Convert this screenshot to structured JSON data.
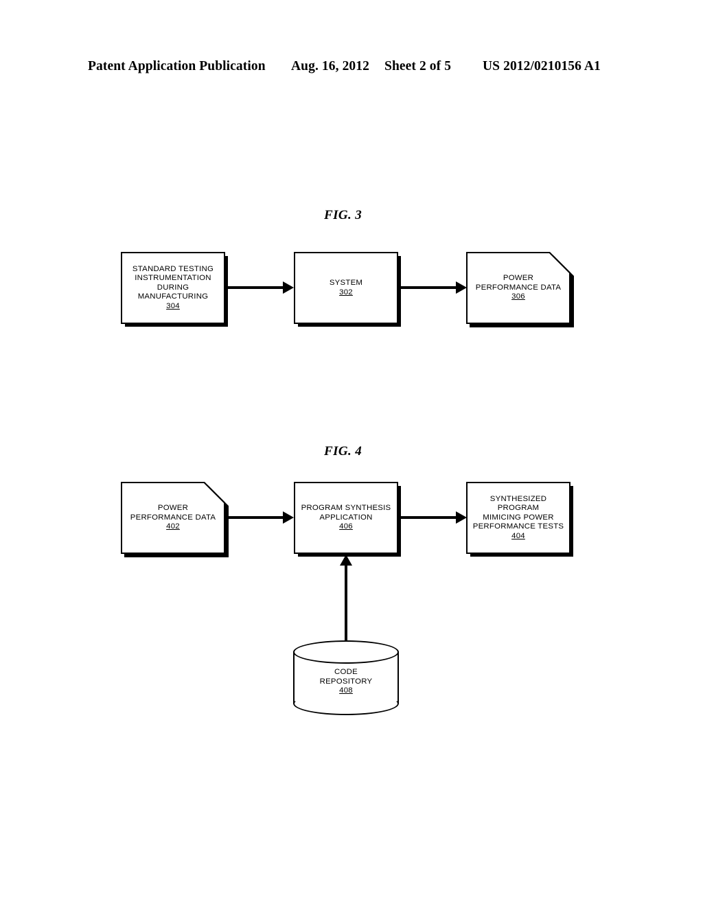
{
  "header": {
    "publication": "Patent Application Publication",
    "date": "Aug. 16, 2012",
    "sheet": "Sheet 2 of 5",
    "patent_number": "US 2012/0210156 A1"
  },
  "figures": [
    {
      "caption": "FIG. 3",
      "nodes": [
        {
          "id": "standard-testing-instrumentation",
          "shape": "rectangle",
          "lines": [
            "STANDARD TESTING",
            "INSTRUMENTATION",
            "DURING",
            "MANUFACTURING"
          ],
          "ref": "304"
        },
        {
          "id": "system",
          "shape": "rectangle",
          "lines": [
            "SYSTEM"
          ],
          "ref": "302"
        },
        {
          "id": "power-performance-data",
          "shape": "document",
          "lines": [
            "POWER",
            "PERFORMANCE DATA"
          ],
          "ref": "306"
        }
      ],
      "arrows": [
        {
          "id": "arrow-304-to-302",
          "direction": "right"
        },
        {
          "id": "arrow-302-to-306",
          "direction": "right"
        }
      ]
    },
    {
      "caption": "FIG. 4",
      "nodes": [
        {
          "id": "power-performance-data",
          "shape": "document",
          "lines": [
            "POWER",
            "PERFORMANCE DATA"
          ],
          "ref": "402"
        },
        {
          "id": "program-synthesis-application",
          "shape": "rectangle",
          "lines": [
            "PROGRAM SYNTHESIS",
            "APPLICATION"
          ],
          "ref": "406"
        },
        {
          "id": "synthesized-program",
          "shape": "rectangle",
          "lines": [
            "SYNTHESIZED",
            "PROGRAM",
            "MIMICING POWER",
            "PERFORMANCE TESTS"
          ],
          "ref": "404"
        },
        {
          "id": "code-repository",
          "shape": "cylinder",
          "lines": [
            "CODE",
            "REPOSITORY"
          ],
          "ref": "408"
        }
      ],
      "arrows": [
        {
          "id": "arrow-402-to-406",
          "direction": "right"
        },
        {
          "id": "arrow-406-to-404",
          "direction": "right"
        },
        {
          "id": "arrow-408-to-406",
          "direction": "up"
        }
      ]
    }
  ]
}
